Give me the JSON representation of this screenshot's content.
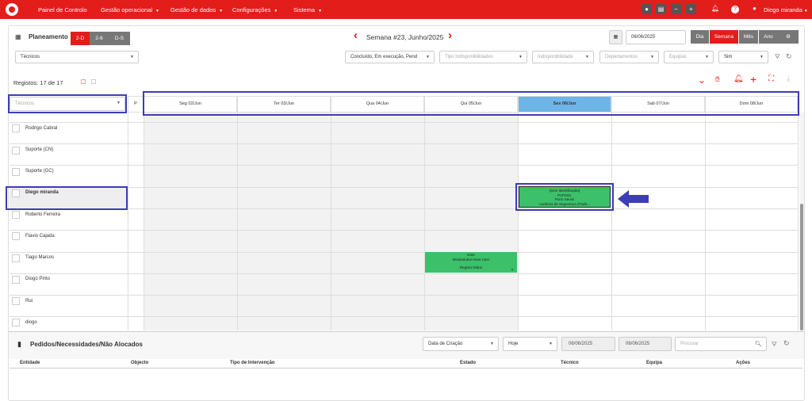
{
  "nav": {
    "items": [
      {
        "label": "Painel de Controlo",
        "caret": false
      },
      {
        "label": "Gestão operacional",
        "caret": true
      },
      {
        "label": "Gestão de dados",
        "caret": true
      },
      {
        "label": "Configurações",
        "caret": true
      },
      {
        "label": "Sistema",
        "caret": true
      }
    ],
    "user": "Diego miranda"
  },
  "toolbar": {
    "title": "Planeamento",
    "views": [
      "2-D",
      "2-6",
      "D-S"
    ],
    "week_label": "Semana #23, Junho/2025",
    "date": "06/06/2025",
    "modes": [
      "Dia",
      "Semana",
      "Mês",
      "Ano"
    ]
  },
  "filters": {
    "tecnicos": "Técnicos",
    "estado": "Concluído, Em execução, Pend",
    "tipo_indisp": "Tipo Indisponibilidades",
    "indisp": "Indisponibilidade",
    "departamentos": "Departamentos",
    "equipas": "Equipas",
    "sim": "Sim"
  },
  "grid": {
    "registos": "Registos: 17 de 17",
    "tecnicos_filter": "Técnicos",
    "p_header": "P",
    "days": [
      "Seg 02/Jun",
      "Ter 03/Jun",
      "Qua 04/Jun",
      "Qui 05/Jun",
      "Sex 06/Jun",
      "Sab 07/Jun",
      "Dom 08/Jun"
    ],
    "rows": [
      "Rodrigo Cabral",
      "Suporte (CN)",
      "Suporte (GC)",
      "Diego miranda",
      "Roberto Ferreira",
      "Flavio Cajada",
      "Tiago Marcos",
      "Diogo Pinto",
      "Rui",
      "diogo"
    ]
  },
  "events": {
    "e1": [
      "[Sem Identificação]",
      "PAPSOL",
      "Porto Seuss",
      "Auditoria de Segurança (PadS..."
    ],
    "e2": [
      "teste",
      "Mindsolution Next User",
      "",
      "Registo Diário"
    ]
  },
  "bottom": {
    "title": "Pedidos/Necessidades/Não Alocados",
    "sort": "Data de Criação",
    "period": "Hoje",
    "date_from": "06/06/2025",
    "date_to": "06/06/2025",
    "search_placeholder": "Procurar",
    "columns": [
      "Entidade",
      "Objecto",
      "Tipo de Intervenção",
      "Estado",
      "Técnico",
      "Equipa",
      "Ações"
    ]
  },
  "colors": {
    "brand": "#e31d1a",
    "event_green": "#3cc06a",
    "today": "#6fb4e6",
    "highlight": "#3d3db5"
  }
}
